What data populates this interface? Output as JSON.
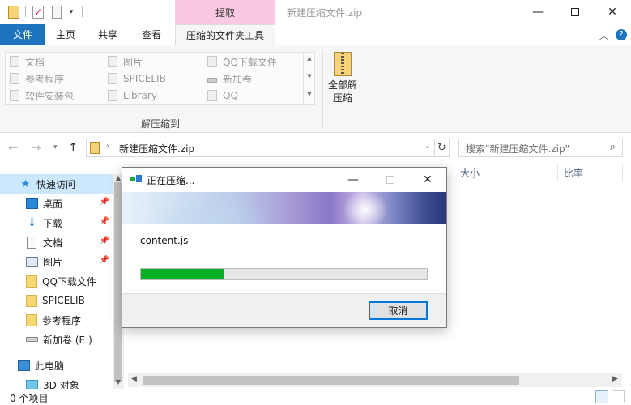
{
  "window": {
    "title": "新建压缩文件.zip",
    "context_tab_label": "提取",
    "minimize_icon": "minimize-icon",
    "maximize_icon": "maximize-icon",
    "close_icon": "close-icon"
  },
  "ribbon_tabs": {
    "file": "文件",
    "home": "主页",
    "share": "共享",
    "view": "查看",
    "compressed_tools": "压缩的文件夹工具"
  },
  "ribbon": {
    "gallery_items": [
      {
        "label": "文档",
        "icon": "document-icon"
      },
      {
        "label": "参考程序",
        "icon": "folder-icon"
      },
      {
        "label": "软件安装包",
        "icon": "folder-icon"
      },
      {
        "label": "图片",
        "icon": "picture-icon"
      },
      {
        "label": "SPICELIB",
        "icon": "folder-icon"
      },
      {
        "label": "Library",
        "icon": "folder-icon"
      },
      {
        "label": "QQ下载文件",
        "icon": "folder-icon"
      },
      {
        "label": "新加卷",
        "icon": "drive-icon"
      },
      {
        "label": "QQ",
        "icon": "folder-icon"
      }
    ],
    "group_label": "解压缩到",
    "extract_all_line1": "全部解",
    "extract_all_line2": "压缩"
  },
  "address": {
    "path": "新建压缩文件.zip",
    "search_placeholder": "搜索\"新建压缩文件.zip\""
  },
  "nav_pane": {
    "quick_access": "快速访问",
    "items": [
      {
        "label": "桌面",
        "icon": "desktop-icon",
        "pinned": true
      },
      {
        "label": "下载",
        "icon": "download-icon",
        "pinned": true
      },
      {
        "label": "文档",
        "icon": "document-icon",
        "pinned": true
      },
      {
        "label": "图片",
        "icon": "picture-icon",
        "pinned": true
      },
      {
        "label": "QQ下载文件",
        "icon": "folder-icon",
        "pinned": false
      },
      {
        "label": "SPICELIB",
        "icon": "folder-icon",
        "pinned": false
      },
      {
        "label": "参考程序",
        "icon": "folder-icon",
        "pinned": false
      },
      {
        "label": "新加卷 (E:)",
        "icon": "drive-icon",
        "pinned": false
      }
    ],
    "this_pc": "此电脑",
    "objects_3d": "3D 对象"
  },
  "columns": {
    "size": "大小",
    "ratio": "比率"
  },
  "status": {
    "item_count": "0 个项目"
  },
  "dialog": {
    "title": "正在压缩...",
    "current_file": "content.js",
    "progress_fraction": 0.29,
    "cancel_label": "取消"
  },
  "colors": {
    "accent": "#1e73be",
    "context_tab": "#f9c9e2",
    "progress": "#06b025",
    "selection": "#cce8ff"
  }
}
